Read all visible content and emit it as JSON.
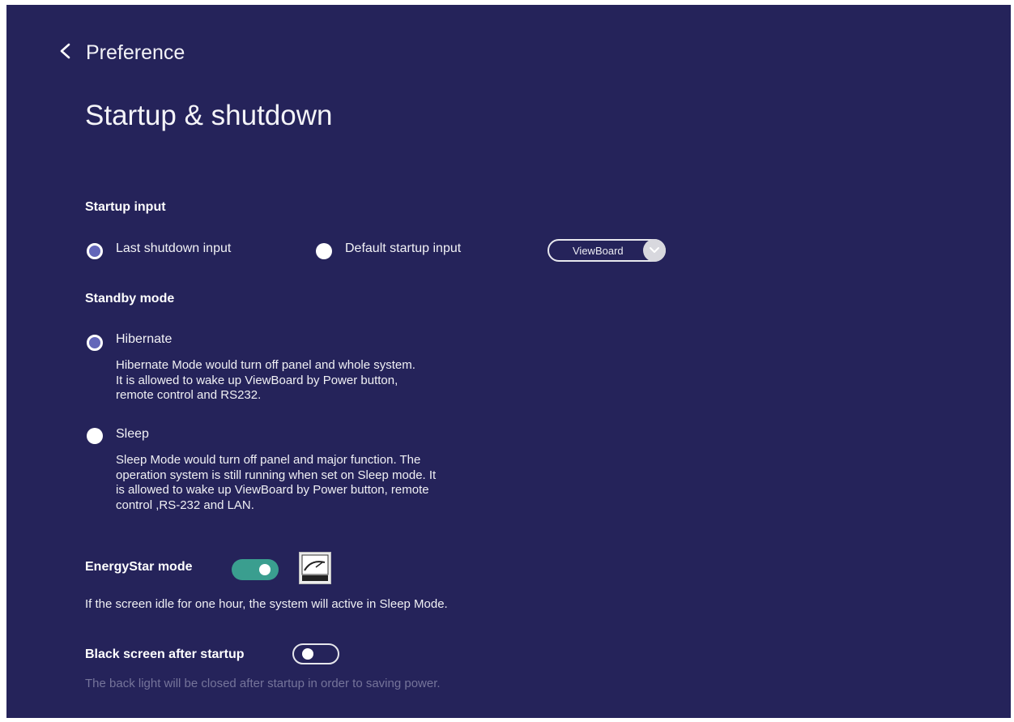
{
  "header": {
    "back_icon": "chevron-left-icon",
    "breadcrumb": "Preference",
    "title": "Startup & shutdown"
  },
  "startup_input": {
    "label": "Startup input",
    "options": [
      {
        "label": "Last shutdown input",
        "selected": true
      },
      {
        "label": "Default startup input",
        "selected": false
      }
    ],
    "default_source": {
      "value": "ViewBoard",
      "icon": "chevron-down-icon"
    }
  },
  "standby_mode": {
    "label": "Standby mode",
    "options": [
      {
        "label": "Hibernate",
        "selected": true,
        "description": "Hibernate Mode would turn off panel and whole system.\nIt is allowed to wake up ViewBoard by Power button,\nremote control and RS232."
      },
      {
        "label": "Sleep",
        "selected": false,
        "description": "Sleep Mode would turn off panel and major function. The\noperation system is still running when set on Sleep mode. It\nis allowed to wake up ViewBoard by Power button, remote\ncontrol ,RS-232 and LAN."
      }
    ]
  },
  "energystar": {
    "label": "EnergyStar mode",
    "enabled": true,
    "logo_icon": "energy-star-logo-icon",
    "description": "If the screen idle for one hour, the system will active in Sleep Mode."
  },
  "black_screen": {
    "label": "Black screen after startup",
    "enabled": false,
    "description": "The back light will be closed after startup in order to saving power."
  },
  "colors": {
    "background": "#25235a",
    "radio_selected": "#6366b9",
    "toggle_on": "#3a9e8f",
    "muted_text": "#75749a"
  }
}
